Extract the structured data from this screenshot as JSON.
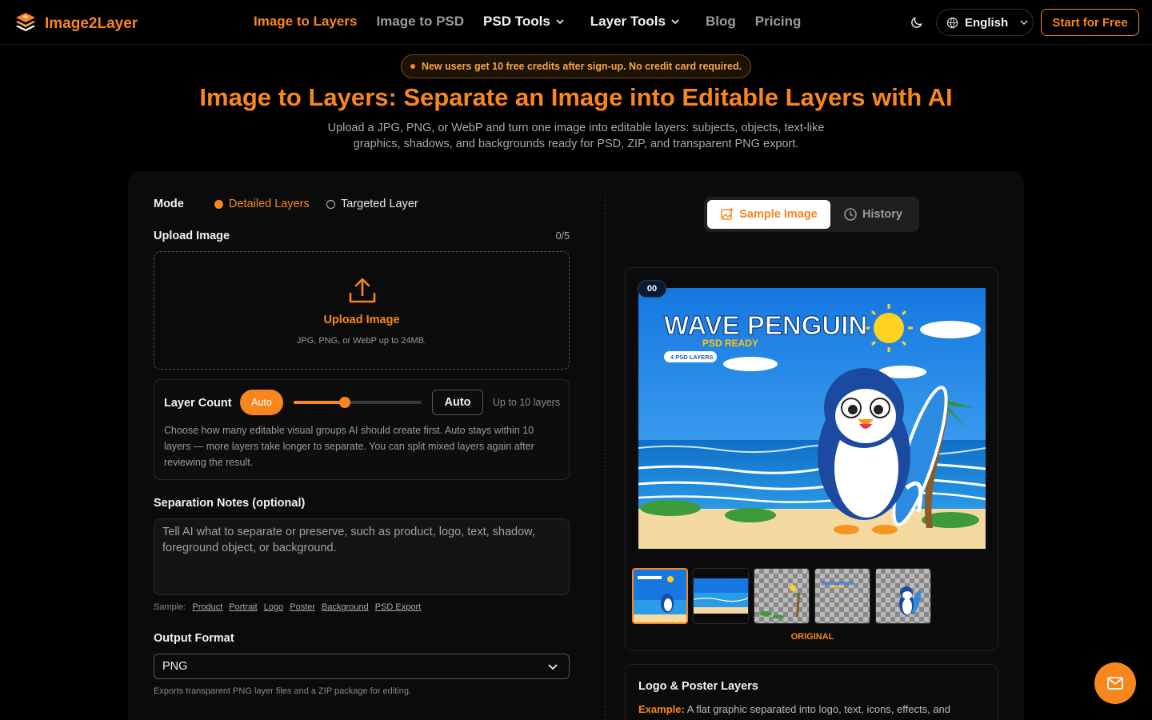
{
  "brand": {
    "name": "Image2Layer"
  },
  "nav": {
    "items": [
      {
        "label": "Image to Layers"
      },
      {
        "label": "Image to PSD"
      },
      {
        "label": "PSD Tools"
      },
      {
        "label": "Layer Tools"
      },
      {
        "label": "Blog"
      },
      {
        "label": "Pricing"
      }
    ],
    "language": "English",
    "cta": "Start for Free"
  },
  "promo": "New users get 10 free credits after sign-up. No credit card required.",
  "hero": {
    "title": "Image to Layers: Separate an Image into Editable Layers with AI",
    "subtitle": "Upload a JPG, PNG, or WebP and turn one image into editable layers: subjects, objects, text-like graphics, shadows, and backgrounds ready for PSD, ZIP, and transparent PNG export."
  },
  "form": {
    "mode_label": "Mode",
    "mode_options": [
      "Detailed Layers",
      "Targeted Layer"
    ],
    "upload_label": "Upload Image",
    "upload_count": "0/5",
    "upload_button": "Upload Image",
    "upload_hint": "JPG, PNG, or WebP up to 24MB.",
    "layer_count": {
      "label": "Layer Count",
      "pill": "Auto",
      "value": "Auto",
      "slider_fraction": 0.4,
      "max_hint": "Up to 10 layers",
      "description": "Choose how many editable visual groups AI should create first. Auto stays within 10 layers — more layers take longer to separate. You can split mixed layers again after reviewing the result."
    },
    "notes_label": "Separation Notes (optional)",
    "notes_placeholder": "Tell AI what to separate or preserve, such as product, logo, text, shadow, foreground object, or background.",
    "samples_label": "Sample:",
    "samples": [
      "Product",
      "Portrait",
      "Logo",
      "Poster",
      "Background",
      "PSD Export"
    ],
    "output_label": "Output Format",
    "output_value": "PNG",
    "output_hint": "Exports transparent PNG layer files and a ZIP package for editing."
  },
  "preview": {
    "tabs": [
      "Sample Image",
      "History"
    ],
    "badge": "00",
    "image_text": {
      "headline": "WAVE PENGUIN",
      "tag1": "PSD READY",
      "tag2": "4 PSD LAYERS"
    },
    "thumb_caption": "ORIGINAL"
  },
  "info": {
    "title": "Logo & Poster Layers",
    "example_label": "Example:",
    "example_text": "A flat graphic separated into logo, text, icons, effects, and"
  },
  "colors": {
    "accent": "#f7861f",
    "background": "#000000"
  }
}
